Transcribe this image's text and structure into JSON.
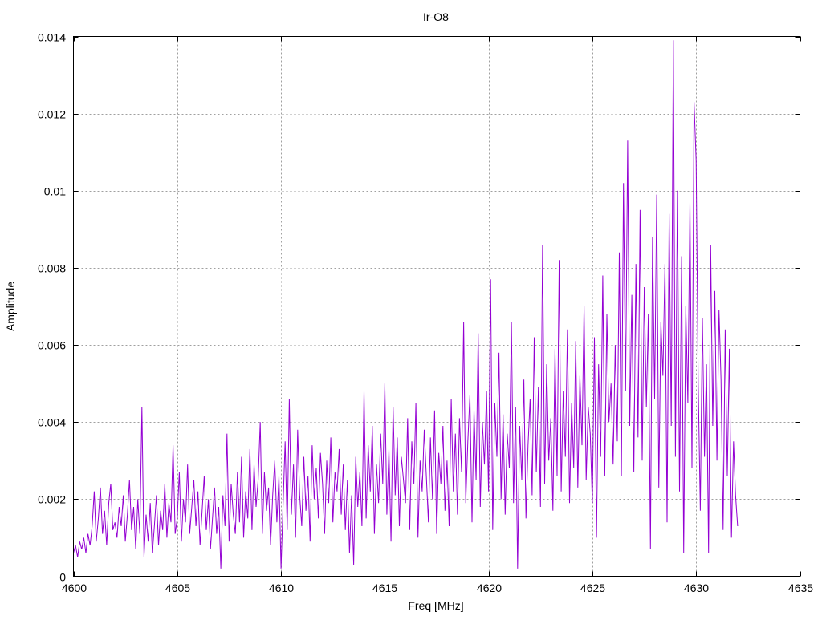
{
  "chart_data": {
    "type": "line",
    "title": "Ir-O8",
    "xlabel": "Freq [MHz]",
    "ylabel": "Amplitude",
    "xlim": [
      4600,
      4635
    ],
    "ylim": [
      0,
      0.014
    ],
    "xticks": [
      "4600",
      "4605",
      "4610",
      "4615",
      "4620",
      "4625",
      "4630",
      "4635"
    ],
    "yticks": [
      "0",
      "0.002",
      "0.004",
      "0.006",
      "0.008",
      "0.01",
      "0.012",
      "0.014"
    ],
    "grid": true,
    "legend": "none",
    "series": [
      {
        "name": "Ir-O8",
        "color": "#9400d3",
        "x_start": 4600,
        "x_step": 0.1,
        "values": [
          0.0006,
          0.0008,
          0.0005,
          0.0009,
          0.0007,
          0.001,
          0.0006,
          0.0011,
          0.0008,
          0.0013,
          0.0022,
          0.0009,
          0.0015,
          0.0023,
          0.0011,
          0.0017,
          0.0008,
          0.0019,
          0.0024,
          0.0012,
          0.0014,
          0.001,
          0.0018,
          0.0013,
          0.0021,
          0.0009,
          0.0016,
          0.0025,
          0.0012,
          0.0018,
          0.0007,
          0.002,
          0.0011,
          0.0044,
          0.0005,
          0.0016,
          0.0009,
          0.0019,
          0.0006,
          0.0013,
          0.0021,
          0.0008,
          0.0017,
          0.0012,
          0.0024,
          0.001,
          0.0019,
          0.0014,
          0.0034,
          0.0011,
          0.0015,
          0.0027,
          0.0009,
          0.002,
          0.0014,
          0.0029,
          0.0011,
          0.0018,
          0.0025,
          0.0013,
          0.0022,
          0.0008,
          0.0017,
          0.0026,
          0.0012,
          0.002,
          0.0007,
          0.0015,
          0.0023,
          0.0011,
          0.0018,
          0.0002,
          0.0021,
          0.0013,
          0.0037,
          0.0009,
          0.0024,
          0.0016,
          0.0011,
          0.0027,
          0.0014,
          0.0031,
          0.001,
          0.0022,
          0.0015,
          0.0033,
          0.0012,
          0.0029,
          0.0018,
          0.0025,
          0.004,
          0.0011,
          0.0027,
          0.0017,
          0.0023,
          0.0008,
          0.0021,
          0.003,
          0.0014,
          0.0026,
          0.0002,
          0.0019,
          0.0035,
          0.0012,
          0.0046,
          0.0016,
          0.0029,
          0.001,
          0.0038,
          0.0021,
          0.0013,
          0.0031,
          0.0017,
          0.0026,
          0.0009,
          0.0034,
          0.002,
          0.0028,
          0.0015,
          0.0032,
          0.0024,
          0.0011,
          0.003,
          0.0019,
          0.0036,
          0.0014,
          0.0027,
          0.0022,
          0.0033,
          0.0016,
          0.0029,
          0.0012,
          0.0025,
          0.0006,
          0.0021,
          0.0003,
          0.0031,
          0.0018,
          0.0027,
          0.0013,
          0.0048,
          0.0015,
          0.0034,
          0.0022,
          0.0039,
          0.0011,
          0.0029,
          0.0019,
          0.0037,
          0.0024,
          0.005,
          0.0016,
          0.0033,
          0.0009,
          0.0044,
          0.0021,
          0.0036,
          0.0013,
          0.0031,
          0.0025,
          0.0019,
          0.0041,
          0.0012,
          0.0035,
          0.0024,
          0.0045,
          0.001,
          0.003,
          0.0022,
          0.0038,
          0.0026,
          0.0014,
          0.0036,
          0.002,
          0.0043,
          0.0011,
          0.0032,
          0.0024,
          0.0039,
          0.0017,
          0.003,
          0.0013,
          0.0046,
          0.0022,
          0.0037,
          0.0016,
          0.0041,
          0.0027,
          0.0066,
          0.0019,
          0.0035,
          0.0047,
          0.0014,
          0.0043,
          0.0025,
          0.0063,
          0.0018,
          0.004,
          0.0029,
          0.0048,
          0.0022,
          0.0077,
          0.0012,
          0.0045,
          0.0031,
          0.0058,
          0.002,
          0.0042,
          0.0016,
          0.0037,
          0.0028,
          0.0066,
          0.0019,
          0.0044,
          0.0002,
          0.0039,
          0.0025,
          0.0051,
          0.0015,
          0.0034,
          0.0046,
          0.0021,
          0.0062,
          0.0027,
          0.0049,
          0.0018,
          0.0086,
          0.0024,
          0.0055,
          0.003,
          0.0041,
          0.0017,
          0.0059,
          0.0026,
          0.0082,
          0.0022,
          0.0048,
          0.0031,
          0.0064,
          0.0019,
          0.0045,
          0.0028,
          0.0061,
          0.0023,
          0.0052,
          0.0034,
          0.007,
          0.0025,
          0.0044,
          0.0037,
          0.0019,
          0.0062,
          0.001,
          0.0055,
          0.0031,
          0.0078,
          0.0026,
          0.0068,
          0.004,
          0.005,
          0.0029,
          0.006,
          0.0035,
          0.0084,
          0.0026,
          0.0102,
          0.0048,
          0.0113,
          0.0039,
          0.0073,
          0.0027,
          0.0081,
          0.0036,
          0.0095,
          0.003,
          0.0075,
          0.0044,
          0.0068,
          0.0007,
          0.0088,
          0.0046,
          0.0099,
          0.0023,
          0.0066,
          0.0052,
          0.0081,
          0.0014,
          0.0094,
          0.0039,
          0.0139,
          0.0031,
          0.01,
          0.0022,
          0.0083,
          0.0006,
          0.007,
          0.0045,
          0.0097,
          0.0028,
          0.0123,
          0.0108,
          0.005,
          0.0017,
          0.0067,
          0.0031,
          0.0055,
          0.0006,
          0.0086,
          0.0039,
          0.0074,
          0.003,
          0.0069,
          0.0051,
          0.0012,
          0.0064,
          0.0026,
          0.0059,
          0.001,
          0.0035,
          0.0021,
          0.0013
        ]
      }
    ]
  }
}
